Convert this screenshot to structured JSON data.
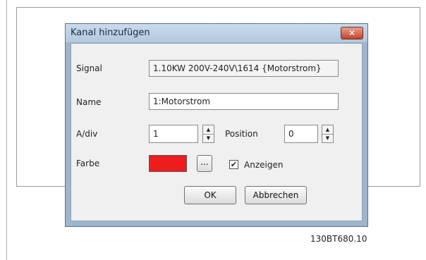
{
  "dialog": {
    "title": "Kanal hinzufügen",
    "close_icon_glyph": "✕"
  },
  "form": {
    "signal_label": "Signal",
    "signal_value": "1.10KW 200V-240V\\1614 {Motorstrom}",
    "name_label": "Name",
    "name_value": "1:Motorstrom",
    "adiv_label": "A/div",
    "adiv_value": "1",
    "position_label": "Position",
    "position_value": "0",
    "farbe_label": "Farbe",
    "color_value": "#ee1c1c",
    "browse_label": "...",
    "show_label": "Anzeigen",
    "show_checked": true
  },
  "buttons": {
    "ok_label": "OK",
    "cancel_label": "Abbrechen"
  },
  "figure_number": "130BT680.10"
}
